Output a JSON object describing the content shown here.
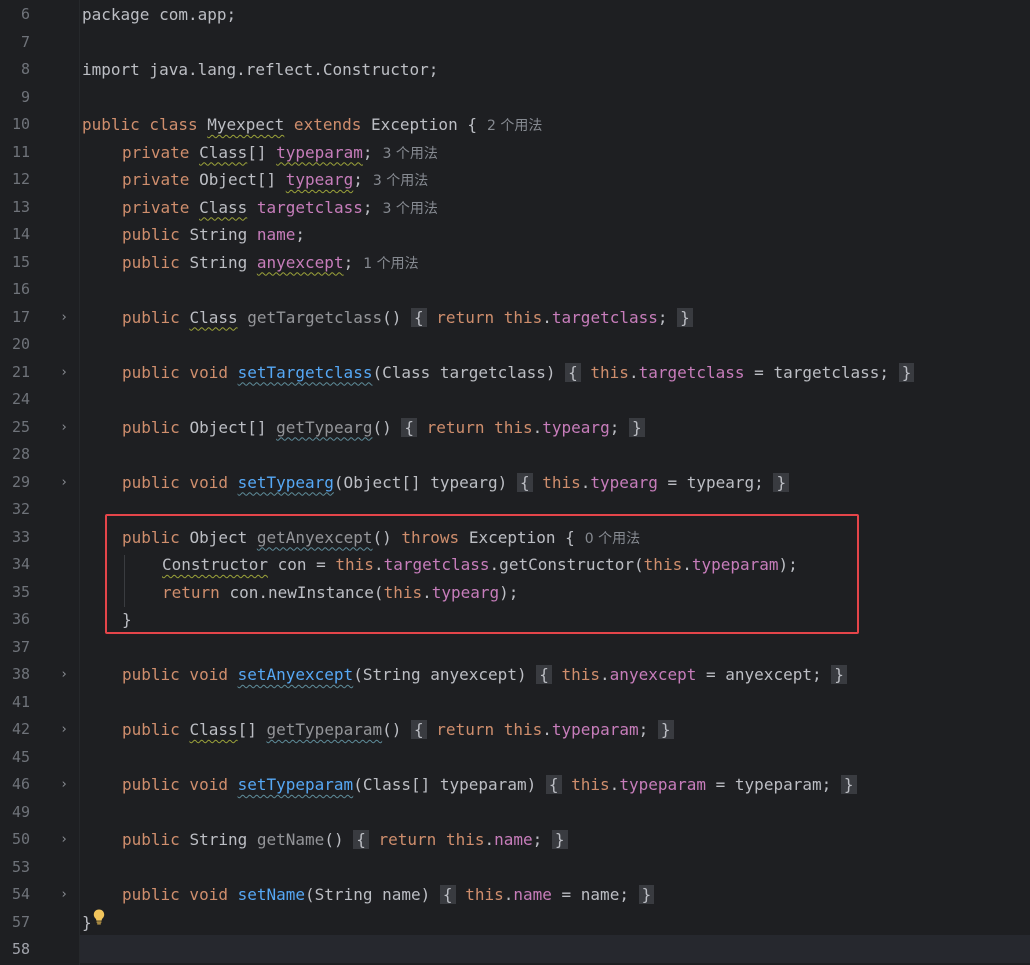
{
  "editor": {
    "lines": [
      {
        "num": "6",
        "text": "package com.app;"
      },
      {
        "num": "7",
        "text": ""
      },
      {
        "num": "8",
        "text": "import java.lang.reflect.Constructor;"
      },
      {
        "num": "9",
        "text": ""
      },
      {
        "num": "10",
        "kw1": "public class ",
        "cls": "Myexpect",
        "kw2": " extends ",
        "rest": "Exception {",
        "hint": "2 个用法"
      },
      {
        "num": "11",
        "kw": "private ",
        "type": "Class",
        "suffix": "[] ",
        "field": "typeparam",
        "end": ";",
        "hint": "3 个用法"
      },
      {
        "num": "12",
        "kw": "private ",
        "type": "Object[] ",
        "field": "typearg",
        "end": ";",
        "hint": "3 个用法"
      },
      {
        "num": "13",
        "kw": "private ",
        "type": "Class",
        "sp": " ",
        "field": "targetclass",
        "end": ";",
        "hint": "3 个用法"
      },
      {
        "num": "14",
        "kw": "public ",
        "type": "String ",
        "field": "name",
        "end": ";"
      },
      {
        "num": "15",
        "kw": "public ",
        "type": "String ",
        "field": "anyexcept",
        "end": ";",
        "hint": "1 个用法"
      },
      {
        "num": "16",
        "text": ""
      },
      {
        "num": "17",
        "kw": "public ",
        "type": "Class",
        "sp": " ",
        "method": "getTargetclass",
        "args": "()",
        "open": "{",
        "ret": "return ",
        "this": "this",
        "dot": ".",
        "field": "targetclass",
        "end": ";",
        "close": "}"
      },
      {
        "num": "20",
        "text": ""
      },
      {
        "num": "21",
        "kw": "public void ",
        "method": "setTargetclass",
        "args": "(Class targetclass)",
        "open": "{",
        "this": "this",
        "dot": ".",
        "field": "targetclass",
        "assign": " = targetclass;",
        "close": "}"
      },
      {
        "num": "24",
        "text": ""
      },
      {
        "num": "25",
        "kw": "public ",
        "type": "Object[] ",
        "method": "getTypearg",
        "args": "()",
        "open": "{",
        "ret": "return ",
        "this": "this",
        "dot": ".",
        "field": "typearg",
        "end": ";",
        "close": "}"
      },
      {
        "num": "28",
        "text": ""
      },
      {
        "num": "29",
        "kw": "public void ",
        "method": "setTypearg",
        "args": "(Object[] typearg)",
        "open": "{",
        "this": "this",
        "dot": ".",
        "field": "typearg",
        "assign": " = typearg;",
        "close": "}"
      },
      {
        "num": "32",
        "text": ""
      },
      {
        "num": "33",
        "kw": "public ",
        "type": "Object ",
        "method": "getAnyexcept",
        "args": "() ",
        "throws": "throws ",
        "exc": "Exception {",
        "hint": "0 个用法"
      },
      {
        "num": "34",
        "type": "Constructor",
        "var": " con = ",
        "this": "this",
        "dot": ".",
        "field": "targetclass",
        "call": ".getConstructor(",
        "this2": "this",
        "dot2": ".",
        "field2": "typeparam",
        "end": ");"
      },
      {
        "num": "35",
        "ret": "return ",
        "plain": "con.newInstance(",
        "this": "this",
        "dot": ".",
        "field": "typearg",
        "end": ");"
      },
      {
        "num": "36",
        "text": "}"
      },
      {
        "num": "37",
        "text": ""
      },
      {
        "num": "38",
        "kw": "public void ",
        "method": "setAnyexcept",
        "args": "(String anyexcept)",
        "open": "{",
        "this": "this",
        "dot": ".",
        "field": "anyexcept",
        "assign": " = anyexcept;",
        "close": "}"
      },
      {
        "num": "41",
        "text": ""
      },
      {
        "num": "42",
        "kw": "public ",
        "type": "Class",
        "suffix": "[] ",
        "method": "getTypeparam",
        "args": "()",
        "open": "{",
        "ret": "return ",
        "this": "this",
        "dot": ".",
        "field": "typeparam",
        "end": ";",
        "close": "}"
      },
      {
        "num": "45",
        "text": ""
      },
      {
        "num": "46",
        "kw": "public void ",
        "method": "setTypeparam",
        "args": "(Class[] typeparam)",
        "open": "{",
        "this": "this",
        "dot": ".",
        "field": "typeparam",
        "assign": " = typeparam;",
        "close": "}"
      },
      {
        "num": "49",
        "text": ""
      },
      {
        "num": "50",
        "kw": "public ",
        "type": "String ",
        "method": "getName",
        "args": "()",
        "open": "{",
        "ret": "return ",
        "this": "this",
        "dot": ".",
        "field": "name",
        "end": ";",
        "close": "}"
      },
      {
        "num": "53",
        "text": ""
      },
      {
        "num": "54",
        "kw": "public void ",
        "method": "setName",
        "args": "(String name)",
        "open": "{",
        "this": "this",
        "dot": ".",
        "field": "name",
        "assign": " = name;",
        "close": "}"
      },
      {
        "num": "57",
        "text": "}"
      },
      {
        "num": "58",
        "text": ""
      }
    ]
  },
  "colors": {
    "background": "#1e1f22",
    "keyword": "#cf8e6d",
    "field": "#c77dbb",
    "method": "#56a8f5",
    "text": "#bcbec4",
    "line_number": "#6f737a",
    "highlight_border": "#e5454a"
  },
  "icons": {
    "fold": "chevron-right-icon",
    "intention": "lightbulb-icon"
  }
}
